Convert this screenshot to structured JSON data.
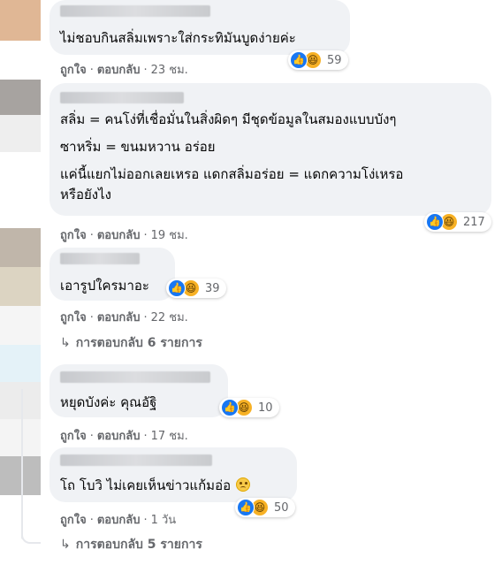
{
  "comments": [
    {
      "text": "ไม่ชอบกินสลิ่มเพราะใส่กระทิมันบูดง่ายค่ะ",
      "reaction_count": "59",
      "like_label": "ถูกใจ",
      "reply_label": "ตอบกลับ",
      "time": "23 ชม."
    },
    {
      "lines": [
        "สลิ่ม = คนโง่ที่เชื่อมั่นในสิ่งผิดๆ มีชุดข้อมูลในสมองแบบบังๆ",
        "ซาหริ่ม = ขนมหวาน อร่อย",
        "แค่นี้แยกไม่ออกเลยเหรอ แดกสลิ่มอร่อย = แดกความโง่เหรอ",
        "หรือยังไง"
      ],
      "reaction_count": "217",
      "like_label": "ถูกใจ",
      "reply_label": "ตอบกลับ",
      "time": "19 ชม."
    },
    {
      "text": "เอารูปใครมาอะ",
      "reaction_count": "39",
      "like_label": "ถูกใจ",
      "reply_label": "ตอบกลับ",
      "time": "22 ชม.",
      "view_replies": "การตอบกลับ 6 รายการ"
    },
    {
      "text": "หยุดบังค่ะ คุณอัฐิ",
      "reaction_count": "10",
      "like_label": "ถูกใจ",
      "reply_label": "ตอบกลับ",
      "time": "17 ชม."
    },
    {
      "text": "โถ โบวิ ไม่เคยเห็นข่าวแก้มอ่อ",
      "reaction_count": "50",
      "like_label": "ถูกใจ",
      "reply_label": "ตอบกลับ",
      "time": "1 วัน",
      "view_replies": "การตอบกลับ 5 รายการ"
    }
  ],
  "icons": {
    "like": "thumbs-up-icon",
    "haha": "laughing-face-icon",
    "reply_arrow": "reply-arrow-icon",
    "sad": "sad-face-icon"
  },
  "colors": {
    "bubble": "#f0f2f5",
    "like": "#1877f2",
    "haha": "#f7b125",
    "meta": "#65676b"
  }
}
